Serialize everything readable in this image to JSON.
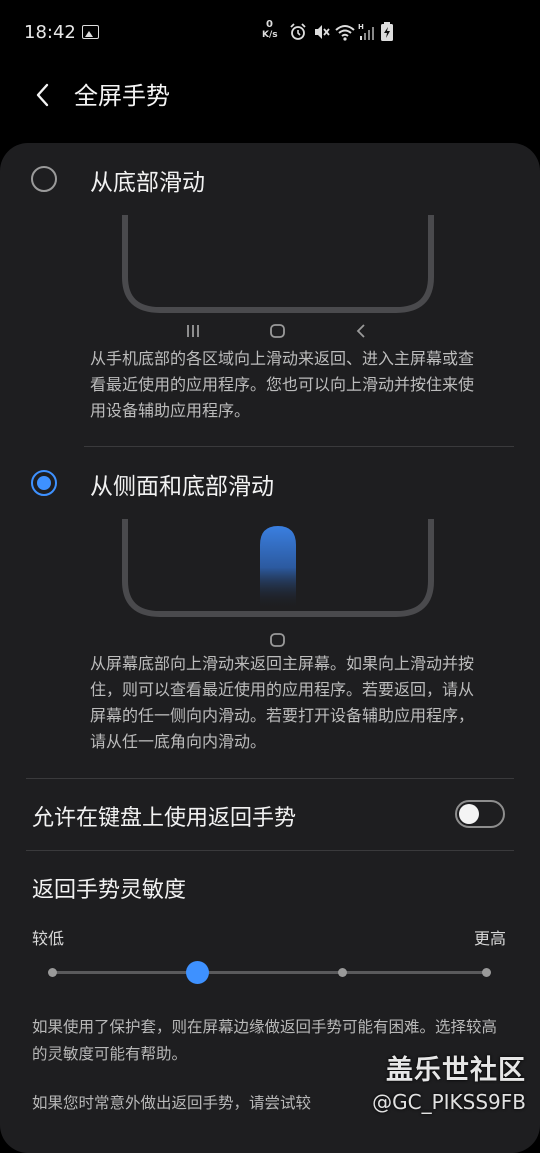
{
  "status_bar": {
    "time": "18:42",
    "net_speed_value": "0",
    "net_speed_unit": "K/s",
    "icons": [
      "image-icon",
      "alarm-icon",
      "mute-icon",
      "wifi-icon",
      "signal-icon",
      "battery-charging-icon"
    ]
  },
  "header": {
    "title": "全屏手势"
  },
  "options": [
    {
      "label": "从底部滑动",
      "selected": false,
      "description": "从手机底部的各区域向上滑动来返回、进入主屏幕或查看最近使用的应用程序。您也可以向上滑动并按住来使用设备辅助应用程序。"
    },
    {
      "label": "从侧面和底部滑动",
      "selected": true,
      "description": "从屏幕底部向上滑动来返回主屏幕。如果向上滑动并按住，则可以查看最近使用的应用程序。若要返回，请从屏幕的任一侧向内滑动。若要打开设备辅助应用程序，请从任一底角向内滑动。"
    }
  ],
  "keyboard_gesture": {
    "label": "允许在键盘上使用返回手势",
    "enabled": false
  },
  "sensitivity": {
    "title": "返回手势灵敏度",
    "low_label": "较低",
    "high_label": "更高",
    "level": 2,
    "levels": 4
  },
  "help_text_1": "如果使用了保护套，则在屏幕边缘做返回手势可能有困难。选择较高的灵敏度可能有帮助。",
  "help_text_2": "如果您时常意外做出返回手势，请尝试较",
  "watermark": {
    "site": "盖乐世社区",
    "user": "@GC_PIKSS9FB"
  },
  "colors": {
    "accent": "#3e91ff",
    "card": "#1e1e20",
    "background": "#000000"
  }
}
